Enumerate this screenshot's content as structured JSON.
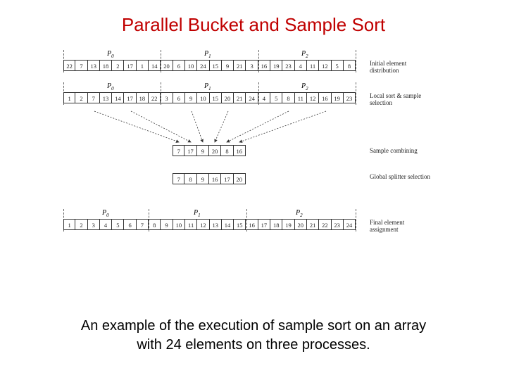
{
  "title": "Parallel Bucket and Sample Sort",
  "caption_line1": "An example of the execution of sample sort on an array",
  "caption_line2": "with 24 elements on three processes.",
  "plabels": [
    "P",
    "P",
    "P"
  ],
  "psubs": [
    "0",
    "1",
    "2"
  ],
  "row1_label": "Initial element\ndistribution",
  "row2_label": "Local sort &\nsample selection",
  "row3_label": "Sample combining",
  "row4_label": "Global splitter\nselection",
  "row5_label": "Final element\nassignment",
  "row1": [
    "22",
    "7",
    "13",
    "18",
    "2",
    "17",
    "1",
    "14",
    "20",
    "6",
    "10",
    "24",
    "15",
    "9",
    "21",
    "3",
    "16",
    "19",
    "23",
    "4",
    "11",
    "12",
    "5",
    "8"
  ],
  "row2": [
    "1",
    "2",
    "7",
    "13",
    "14",
    "17",
    "18",
    "22",
    "3",
    "6",
    "9",
    "10",
    "15",
    "20",
    "21",
    "24",
    "4",
    "5",
    "8",
    "11",
    "12",
    "16",
    "19",
    "23"
  ],
  "row3": [
    "7",
    "17",
    "9",
    "20",
    "8",
    "16"
  ],
  "row4": [
    "7",
    "8",
    "9",
    "16",
    "17",
    "20"
  ],
  "row5": [
    "1",
    "2",
    "3",
    "4",
    "5",
    "6",
    "7",
    "8",
    "9",
    "10",
    "11",
    "12",
    "13",
    "14",
    "15",
    "16",
    "17",
    "18",
    "19",
    "20",
    "21",
    "22",
    "23",
    "24"
  ],
  "row5_breaks": [
    7,
    15
  ]
}
